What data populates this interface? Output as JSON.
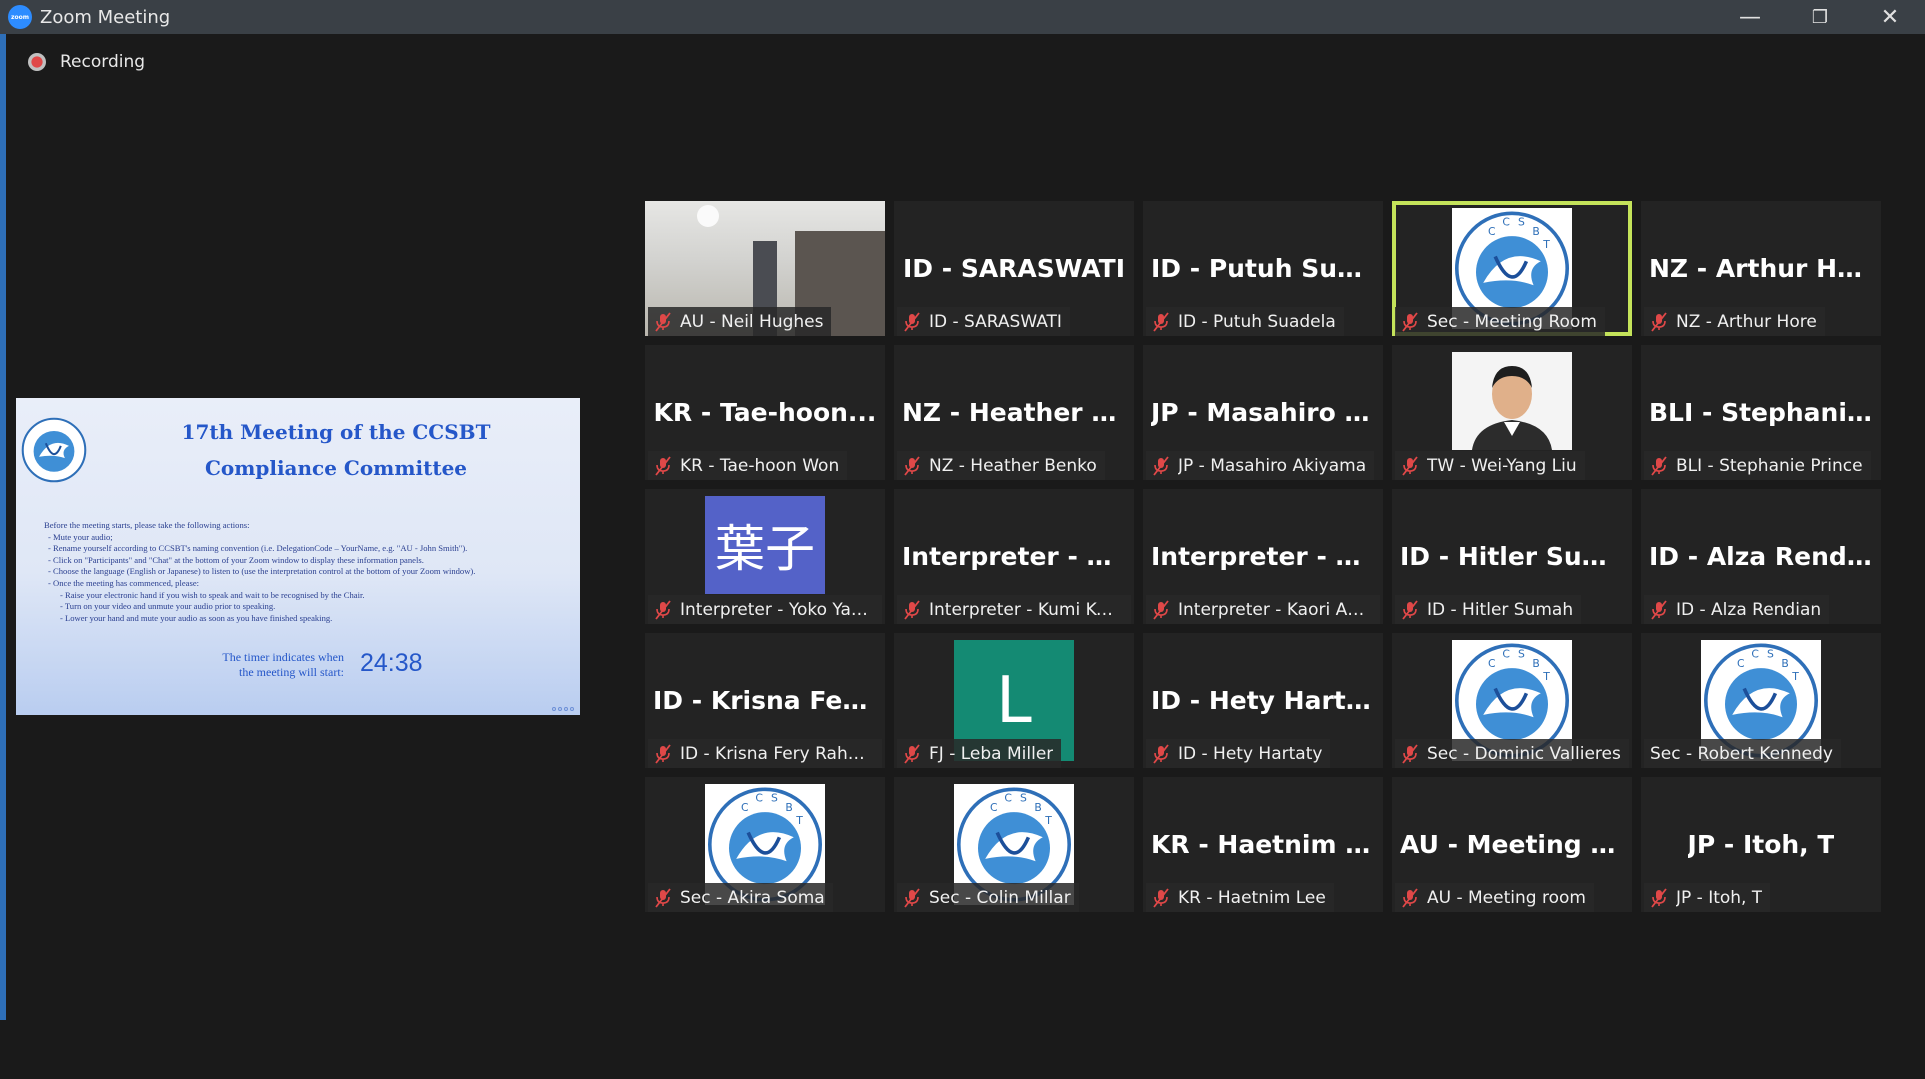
{
  "window": {
    "title": "Zoom Meeting",
    "app_icon_text": "zoom",
    "minimize": "—",
    "restore": "❐",
    "close": "✕"
  },
  "recording": {
    "label": "Recording"
  },
  "shared_screen": {
    "title_line1": "17th Meeting of the CCSBT",
    "title_line2": "Compliance Committee",
    "instructions": [
      "Before the meeting starts, please take the following actions:",
      "- Mute your audio;",
      "- Rename yourself according to CCSBT's naming convention (i.e. DelegationCode – YourName, e.g. \"AU - John Smith\").",
      "- Click on \"Participants\" and \"Chat\" at the bottom of your Zoom window to display these information panels.",
      "- Choose the language (English or Japanese) to listen to (use the interpretation control at the bottom of your Zoom window).",
      "- Once the meeting has commenced, please:",
      "- Raise your electronic hand if you wish to speak and wait to be recognised by the Chair.",
      "- Turn on your video and unmute your audio prior to speaking.",
      "- Lower your hand and mute your audio as soon as you have finished speaking."
    ],
    "timer_label_line1": "The timer indicates when",
    "timer_label_line2": "the meeting will start:",
    "timer_value": "24:38"
  },
  "participants": [
    {
      "label": "AU - Neil Hughes",
      "kind": "photo",
      "muted": true
    },
    {
      "label": "ID - SARASWATI",
      "big": "ID - SARASWATI",
      "kind": "name",
      "muted": true
    },
    {
      "label": "ID - Putuh Suadela",
      "big": "ID - Putuh Suad...",
      "kind": "name",
      "muted": true
    },
    {
      "label": "Sec - Meeting Room",
      "kind": "logo",
      "muted": true,
      "active": true
    },
    {
      "label": "NZ - Arthur Hore",
      "big": "NZ - Arthur Hore",
      "kind": "name",
      "muted": true
    },
    {
      "label": "KR - Tae-hoon Won",
      "big": "KR - Tae-hoon...",
      "kind": "name",
      "muted": true
    },
    {
      "label": "NZ - Heather Benko",
      "big": "NZ - Heather B...",
      "kind": "name",
      "muted": true
    },
    {
      "label": "JP - Masahiro Akiyama",
      "big": "JP - Masahiro A...",
      "kind": "name",
      "muted": true
    },
    {
      "label": "TW - Wei-Yang Liu",
      "kind": "portrait",
      "muted": true
    },
    {
      "label": "BLI - Stephanie Prince",
      "big": "BLI - Stephanie...",
      "kind": "name",
      "muted": true
    },
    {
      "label": "Interpreter - Yoko Yam...",
      "kind": "kanji",
      "kanji": "葉子",
      "muted": true
    },
    {
      "label": "Interpreter - Kumi Koike",
      "big": "Interpreter - Ku...",
      "kind": "name",
      "muted": true
    },
    {
      "label": "Interpreter - Kaori Asaki",
      "big": "Interpreter - Ka...",
      "kind": "name",
      "muted": true
    },
    {
      "label": "ID - Hitler Sumah",
      "big": "ID - Hitler Sumah",
      "kind": "name",
      "muted": true
    },
    {
      "label": "ID - Alza Rendian",
      "big": "ID - Alza Rendian",
      "kind": "name",
      "muted": true
    },
    {
      "label": "ID - Krisna Fery Rahma...",
      "big": "ID - Krisna Fery...",
      "kind": "name",
      "muted": true
    },
    {
      "label": "FJ - Leba Miller",
      "kind": "letter",
      "letter": "L",
      "muted": true
    },
    {
      "label": "ID - Hety Hartaty",
      "big": "ID - Hety Hartaty",
      "kind": "name",
      "muted": true
    },
    {
      "label": "Sec - Dominic Vallieres",
      "kind": "logo",
      "muted": true
    },
    {
      "label": "Sec - Robert Kennedy",
      "kind": "logo",
      "muted": false
    },
    {
      "label": "Sec - Akira Soma",
      "kind": "logo",
      "muted": true
    },
    {
      "label": "Sec - Colin Millar",
      "kind": "logo",
      "muted": true
    },
    {
      "label": "KR - Haetnim Lee",
      "big": "KR - Haetnim Lee",
      "kind": "name",
      "muted": true
    },
    {
      "label": "AU - Meeting room",
      "big": "AU - Meeting r...",
      "kind": "name",
      "muted": true
    },
    {
      "label": "JP - Itoh, T",
      "big": "JP - Itoh, T",
      "kind": "name",
      "muted": true
    }
  ],
  "colors": {
    "active_speaker": "#c4e35a",
    "mute_icon": "#e04848",
    "background": "#1a1a1a"
  }
}
